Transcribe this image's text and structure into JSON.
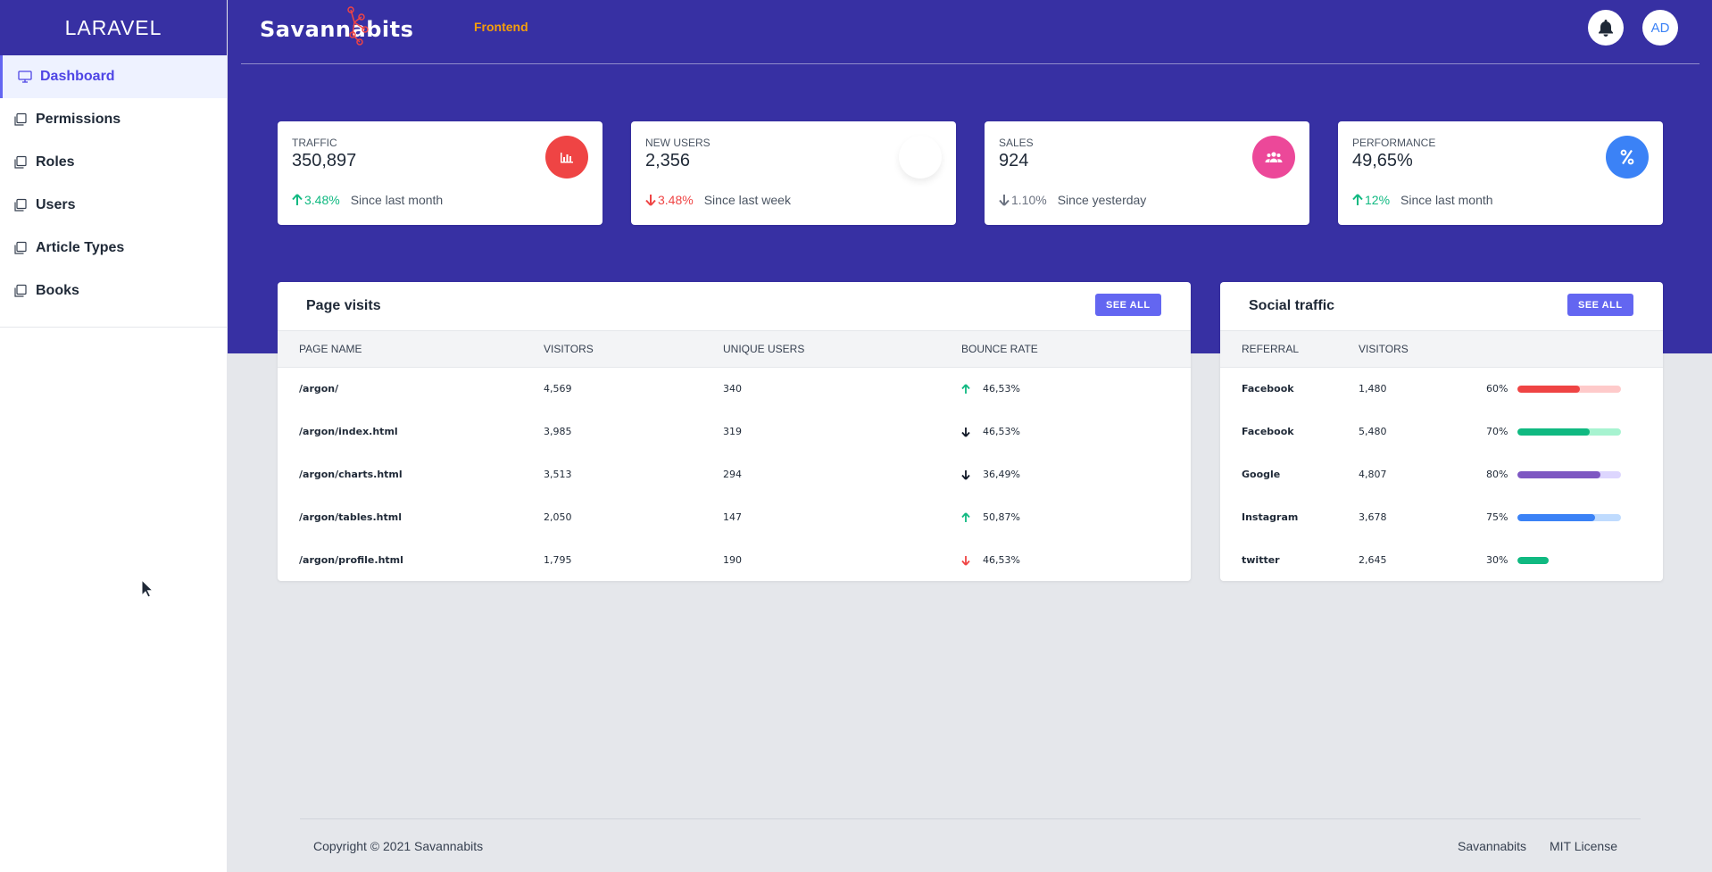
{
  "sidebar": {
    "brand": "LARAVEL",
    "items": [
      {
        "label": "Dashboard",
        "active": true
      },
      {
        "label": "Permissions"
      },
      {
        "label": "Roles"
      },
      {
        "label": "Users"
      },
      {
        "label": "Article Types"
      },
      {
        "label": "Books"
      }
    ]
  },
  "header": {
    "logo_text": "Savannabits",
    "nav_link": "Frontend",
    "avatar_initials": "AD",
    "icons": {
      "notifications": "bell-icon"
    }
  },
  "stats": [
    {
      "label": "TRAFFIC",
      "value": "350,897",
      "change": "3.48%",
      "direction": "up",
      "since": "Since last month",
      "color": "#ef4444",
      "icon": "chart-bar-icon"
    },
    {
      "label": "NEW USERS",
      "value": "2,356",
      "change": "3.48%",
      "direction": "down",
      "since": "Since last week",
      "color": "#ffffff",
      "icon": "chart-pie-icon"
    },
    {
      "label": "SALES",
      "value": "924",
      "change": "1.10%",
      "direction": "down",
      "since": "Since yesterday",
      "color": "#ec4899",
      "icon": "users-icon"
    },
    {
      "label": "PERFORMANCE",
      "value": "49,65%",
      "change": "12%",
      "direction": "up",
      "since": "Since last month",
      "color": "#3b82f6",
      "icon": "percent-icon"
    }
  ],
  "page_visits": {
    "title": "Page visits",
    "see_all": "SEE ALL",
    "headers": [
      "PAGE NAME",
      "VISITORS",
      "UNIQUE USERS",
      "BOUNCE RATE"
    ],
    "rows": [
      {
        "page": "/argon/",
        "visitors": "4,569",
        "unique": "340",
        "bounce": "46,53%",
        "trend": "up-green"
      },
      {
        "page": "/argon/index.html",
        "visitors": "3,985",
        "unique": "319",
        "bounce": "46,53%",
        "trend": "down-black"
      },
      {
        "page": "/argon/charts.html",
        "visitors": "3,513",
        "unique": "294",
        "bounce": "36,49%",
        "trend": "down-black"
      },
      {
        "page": "/argon/tables.html",
        "visitors": "2,050",
        "unique": "147",
        "bounce": "50,87%",
        "trend": "up-green"
      },
      {
        "page": "/argon/profile.html",
        "visitors": "1,795",
        "unique": "190",
        "bounce": "46,53%",
        "trend": "down-red"
      }
    ]
  },
  "social_traffic": {
    "title": "Social traffic",
    "see_all": "SEE ALL",
    "headers": [
      "REFERRAL",
      "VISITORS",
      ""
    ],
    "rows": [
      {
        "referral": "Facebook",
        "visitors": "1,480",
        "percent": "60%",
        "value": 60,
        "color": "#ef4444",
        "track": "#fecaca"
      },
      {
        "referral": "Facebook",
        "visitors": "5,480",
        "percent": "70%",
        "value": 70,
        "color": "#10b981",
        "track": "#a7f3d0"
      },
      {
        "referral": "Google",
        "visitors": "4,807",
        "percent": "80%",
        "value": 80,
        "color": "#7e57c2",
        "track": "#ddd6fe"
      },
      {
        "referral": "Instagram",
        "visitors": "3,678",
        "percent": "75%",
        "value": 75,
        "color": "#3b82f6",
        "track": "#bfdbfe"
      },
      {
        "referral": "twitter",
        "visitors": "2,645",
        "percent": "30%",
        "value": 30,
        "color": "#10b981",
        "track": "#ffffff"
      }
    ]
  },
  "footer": {
    "copyright": "Copyright © 2021 Savannabits",
    "links": [
      "Savannabits",
      "MIT License"
    ]
  }
}
